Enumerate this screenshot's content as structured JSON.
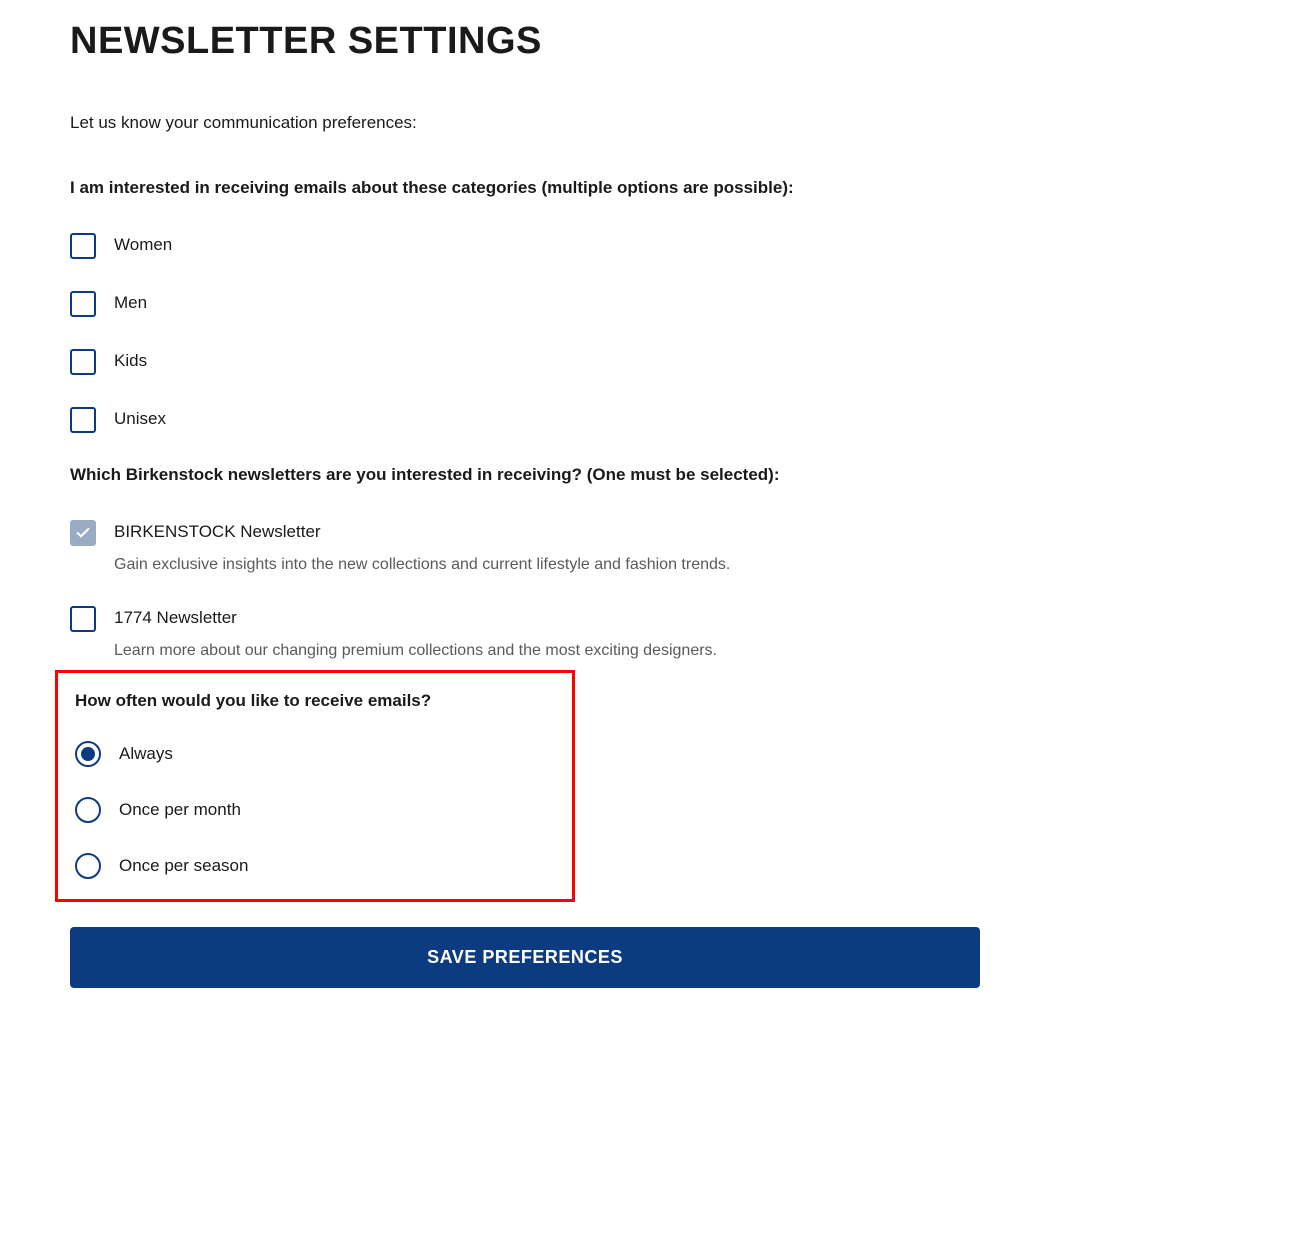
{
  "title": "NEWSLETTER SETTINGS",
  "intro": "Let us know your communication preferences:",
  "categories": {
    "heading": "I am interested in receiving emails about these categories (multiple options are possible):",
    "options": [
      {
        "label": "Women"
      },
      {
        "label": "Men"
      },
      {
        "label": "Kids"
      },
      {
        "label": "Unisex"
      }
    ]
  },
  "newsletters": {
    "heading": "Which Birkenstock newsletters are you interested in receiving? (One must be selected):",
    "options": [
      {
        "label": "BIRKENSTOCK Newsletter",
        "description": "Gain exclusive insights into the new collections and current lifestyle and fashion trends."
      },
      {
        "label": "1774 Newsletter",
        "description": "Learn more about our changing premium collections and the most exciting designers."
      }
    ]
  },
  "frequency": {
    "heading": "How often would you like to receive emails?",
    "options": [
      {
        "label": "Always"
      },
      {
        "label": "Once per month"
      },
      {
        "label": "Once per season"
      }
    ]
  },
  "save_button": "SAVE PREFERENCES"
}
